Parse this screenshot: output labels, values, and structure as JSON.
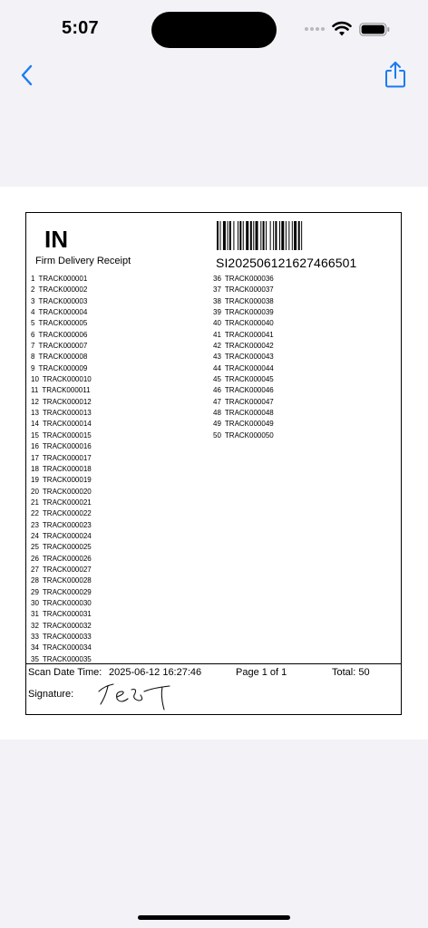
{
  "status_bar": {
    "time": "5:07"
  },
  "nav": {
    "back_icon": "chevron-left-icon",
    "share_icon": "share-icon",
    "accent_color": "#1a7bf2"
  },
  "receipt": {
    "code": "IN",
    "subtitle": "Firm Delivery Receipt",
    "barcode_number": "SI202506121627466501",
    "items_col1": [
      {
        "n": "1",
        "id": "TRACK000001"
      },
      {
        "n": "2",
        "id": "TRACK000002"
      },
      {
        "n": "3",
        "id": "TRACK000003"
      },
      {
        "n": "4",
        "id": "TRACK000004"
      },
      {
        "n": "5",
        "id": "TRACK000005"
      },
      {
        "n": "6",
        "id": "TRACK000006"
      },
      {
        "n": "7",
        "id": "TRACK000007"
      },
      {
        "n": "8",
        "id": "TRACK000008"
      },
      {
        "n": "9",
        "id": "TRACK000009"
      },
      {
        "n": "10",
        "id": "TRACK000010"
      },
      {
        "n": "11",
        "id": "TRACK000011"
      },
      {
        "n": "12",
        "id": "TRACK000012"
      },
      {
        "n": "13",
        "id": "TRACK000013"
      },
      {
        "n": "14",
        "id": "TRACK000014"
      },
      {
        "n": "15",
        "id": "TRACK000015"
      },
      {
        "n": "16",
        "id": "TRACK000016"
      },
      {
        "n": "17",
        "id": "TRACK000017"
      },
      {
        "n": "18",
        "id": "TRACK000018"
      },
      {
        "n": "19",
        "id": "TRACK000019"
      },
      {
        "n": "20",
        "id": "TRACK000020"
      },
      {
        "n": "21",
        "id": "TRACK000021"
      },
      {
        "n": "22",
        "id": "TRACK000022"
      },
      {
        "n": "23",
        "id": "TRACK000023"
      },
      {
        "n": "24",
        "id": "TRACK000024"
      },
      {
        "n": "25",
        "id": "TRACK000025"
      },
      {
        "n": "26",
        "id": "TRACK000026"
      },
      {
        "n": "27",
        "id": "TRACK000027"
      },
      {
        "n": "28",
        "id": "TRACK000028"
      },
      {
        "n": "29",
        "id": "TRACK000029"
      },
      {
        "n": "30",
        "id": "TRACK000030"
      },
      {
        "n": "31",
        "id": "TRACK000031"
      },
      {
        "n": "32",
        "id": "TRACK000032"
      },
      {
        "n": "33",
        "id": "TRACK000033"
      },
      {
        "n": "34",
        "id": "TRACK000034"
      },
      {
        "n": "35",
        "id": "TRACK000035"
      }
    ],
    "items_col2": [
      {
        "n": "36",
        "id": "TRACK000036"
      },
      {
        "n": "37",
        "id": "TRACK000037"
      },
      {
        "n": "38",
        "id": "TRACK000038"
      },
      {
        "n": "39",
        "id": "TRACK000039"
      },
      {
        "n": "40",
        "id": "TRACK000040"
      },
      {
        "n": "41",
        "id": "TRACK000041"
      },
      {
        "n": "42",
        "id": "TRACK000042"
      },
      {
        "n": "43",
        "id": "TRACK000043"
      },
      {
        "n": "44",
        "id": "TRACK000044"
      },
      {
        "n": "45",
        "id": "TRACK000045"
      },
      {
        "n": "46",
        "id": "TRACK000046"
      },
      {
        "n": "47",
        "id": "TRACK000047"
      },
      {
        "n": "48",
        "id": "TRACK000048"
      },
      {
        "n": "49",
        "id": "TRACK000049"
      },
      {
        "n": "50",
        "id": "TRACK000050"
      }
    ],
    "footer": {
      "scan_label": "Scan Date Time:",
      "scan_value": "2025-06-12 16:27:46",
      "page": "Page 1 of 1",
      "total": "Total: 50",
      "signature_label": "Signature:"
    }
  }
}
